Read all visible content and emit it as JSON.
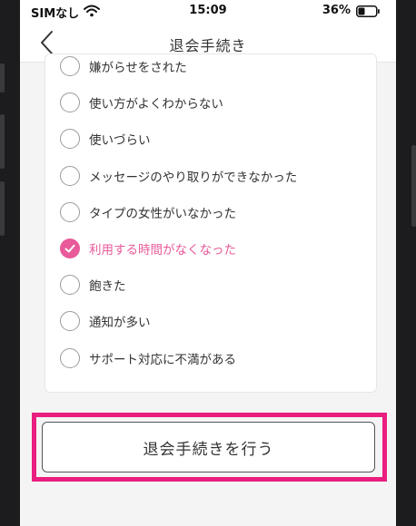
{
  "status_bar": {
    "carrier": "SIMなし",
    "time": "15:09",
    "battery": "36%"
  },
  "nav": {
    "title": "退会手続き"
  },
  "reasons": [
    {
      "label": "嫌がらせをされた",
      "checked": false
    },
    {
      "label": "使い方がよくわからない",
      "checked": false
    },
    {
      "label": "使いづらい",
      "checked": false
    },
    {
      "label": "メッセージのやり取りができなかった",
      "checked": false
    },
    {
      "label": "タイプの女性がいなかった",
      "checked": false
    },
    {
      "label": "利用する時間がなくなった",
      "checked": true
    },
    {
      "label": "飽きた",
      "checked": false
    },
    {
      "label": "通知が多い",
      "checked": false
    },
    {
      "label": "サポート対応に不満がある",
      "checked": false
    }
  ],
  "withdraw_button": {
    "label": "退会手続きを行う"
  },
  "colors": {
    "accent": "#e85a9a",
    "highlight": "#e91e7e"
  },
  "icons": {
    "back": "chevron-left-icon",
    "wifi": "wifi-icon",
    "battery": "battery-icon",
    "check": "check-icon"
  }
}
